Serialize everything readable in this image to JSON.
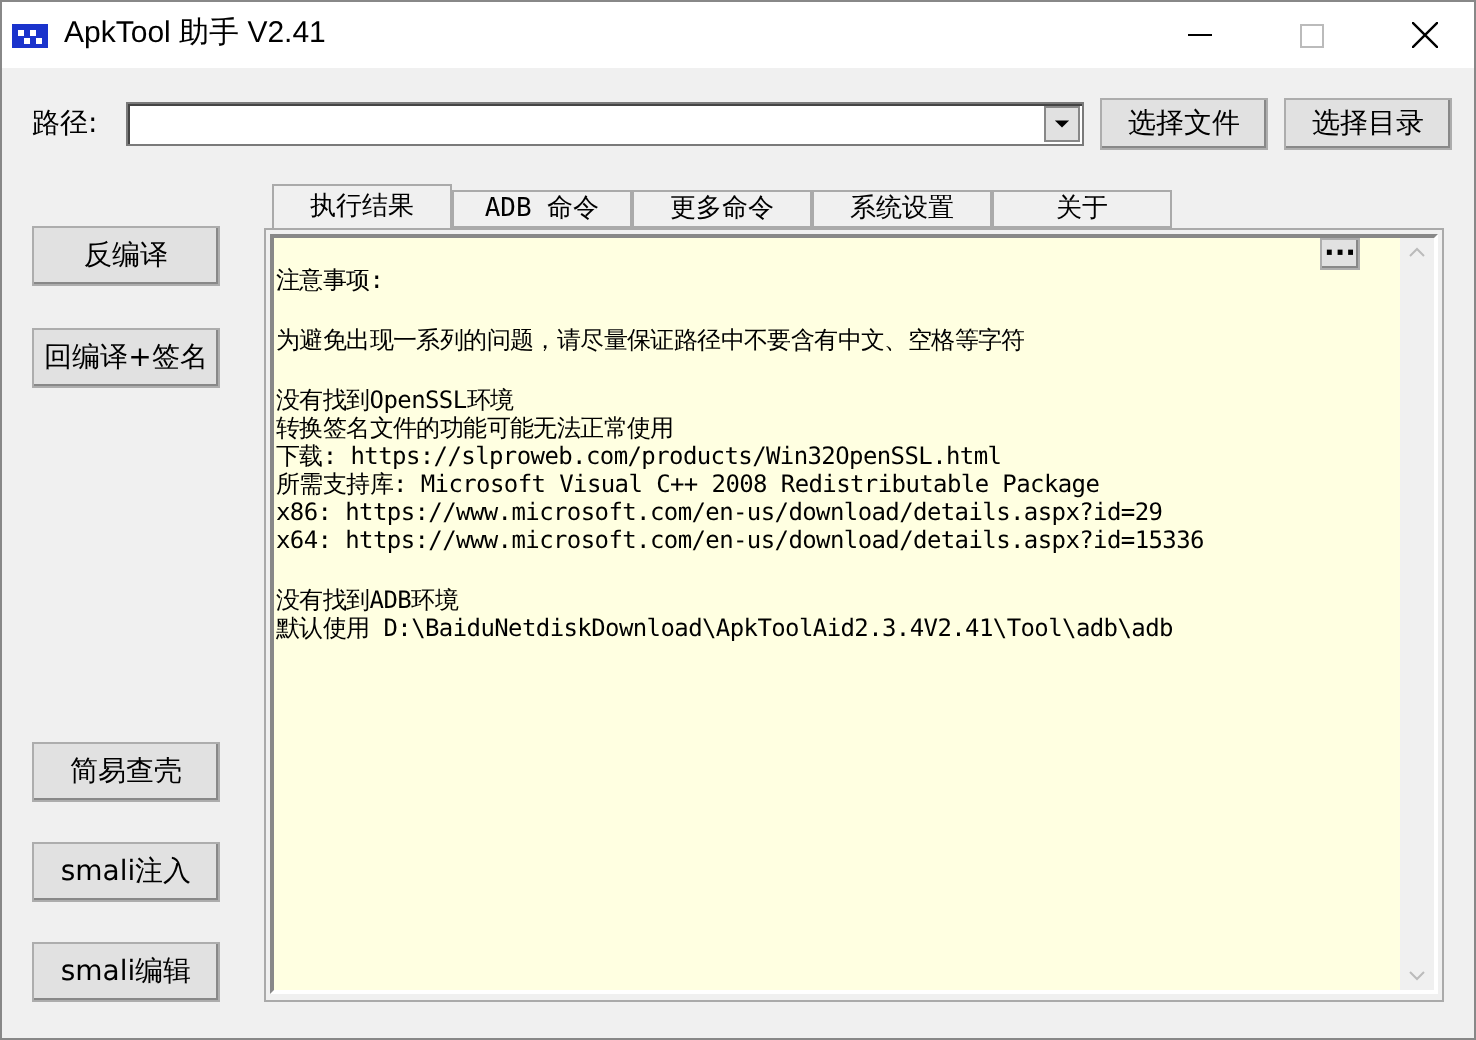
{
  "window": {
    "title": "ApkTool 助手 V2.41"
  },
  "path": {
    "label": "路径:"
  },
  "path_buttons": [
    "选择文件",
    "选择目录"
  ],
  "side_buttons_top": [
    "反编译",
    "回编译+签名"
  ],
  "side_buttons_bottom": [
    "简易查壳",
    "smali注入",
    "smali编辑"
  ],
  "tabs": [
    {
      "label": "执行结果",
      "selected": true
    },
    {
      "label": "ADB 命令",
      "selected": false
    },
    {
      "label": "更多命令",
      "selected": false
    },
    {
      "label": "系统设置",
      "selected": false
    },
    {
      "label": "关于",
      "selected": false
    }
  ],
  "output": {
    "more_button": "···",
    "paragraphs": [
      [
        "注意事项:"
      ],
      [
        "为避免出现一系列的问题，请尽量保证路径中不要含有中文、空格等字符"
      ],
      [
        "没有找到OpenSSL环境",
        "转换签名文件的功能可能无法正常使用",
        "下载: https://slproweb.com/products/Win32OpenSSL.html",
        "所需支持库: Microsoft Visual C++ 2008 Redistributable Package",
        "x86: https://www.microsoft.com/en-us/download/details.aspx?id=29",
        "x64: https://www.microsoft.com/en-us/download/details.aspx?id=15336"
      ],
      [
        "没有找到ADB环境",
        "默认使用 D:\\BaiduNetdiskDownload\\ApkToolAid2.3.4V2.41\\Tool\\adb\\adb"
      ]
    ]
  }
}
